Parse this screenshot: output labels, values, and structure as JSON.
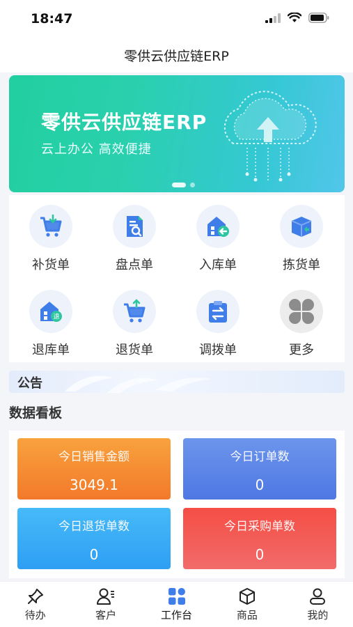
{
  "status_bar": {
    "time": "18:47"
  },
  "nav": {
    "title": "零供云供应链ERP"
  },
  "banner": {
    "title": "零供云供应链ERP",
    "subtitle": "云上办公  高效便捷"
  },
  "menu": {
    "items": [
      {
        "label": "补货单",
        "icon": "cart-download-icon"
      },
      {
        "label": "盘点单",
        "icon": "inventory-check-icon"
      },
      {
        "label": "入库单",
        "icon": "warehouse-in-icon"
      },
      {
        "label": "拣货单",
        "icon": "box-icon"
      },
      {
        "label": "退库单",
        "icon": "warehouse-return-icon"
      },
      {
        "label": "退货单",
        "icon": "cart-return-icon"
      },
      {
        "label": "调拨单",
        "icon": "transfer-icon"
      },
      {
        "label": "更多",
        "icon": "more-grid-icon"
      }
    ]
  },
  "notice": {
    "label": "公告"
  },
  "dashboard": {
    "title": "数据看板",
    "cards": [
      {
        "label": "今日销售金额",
        "value": "3049.1",
        "color_from": "#f8a23e",
        "color_to": "#f3792a"
      },
      {
        "label": "今日订单数",
        "value": "0",
        "color_from": "#6c95ec",
        "color_to": "#4f78e3"
      },
      {
        "label": "今日退货单数",
        "value": "0",
        "color_from": "#46baf8",
        "color_to": "#2e9ff4"
      },
      {
        "label": "今日采购单数",
        "value": "0",
        "color_from": "#f44e45",
        "color_to": "#f26b6a"
      }
    ]
  },
  "tabs": [
    {
      "label": "待办",
      "icon": "pin-icon",
      "active": false
    },
    {
      "label": "客户",
      "icon": "customer-icon",
      "active": false
    },
    {
      "label": "工作台",
      "icon": "workbench-icon",
      "active": true
    },
    {
      "label": "商品",
      "icon": "product-cube-icon",
      "active": false
    },
    {
      "label": "我的",
      "icon": "profile-icon",
      "active": false
    }
  ],
  "colors": {
    "accent_blue": "#3f7ee8",
    "banner_green": "#21cfa0"
  }
}
